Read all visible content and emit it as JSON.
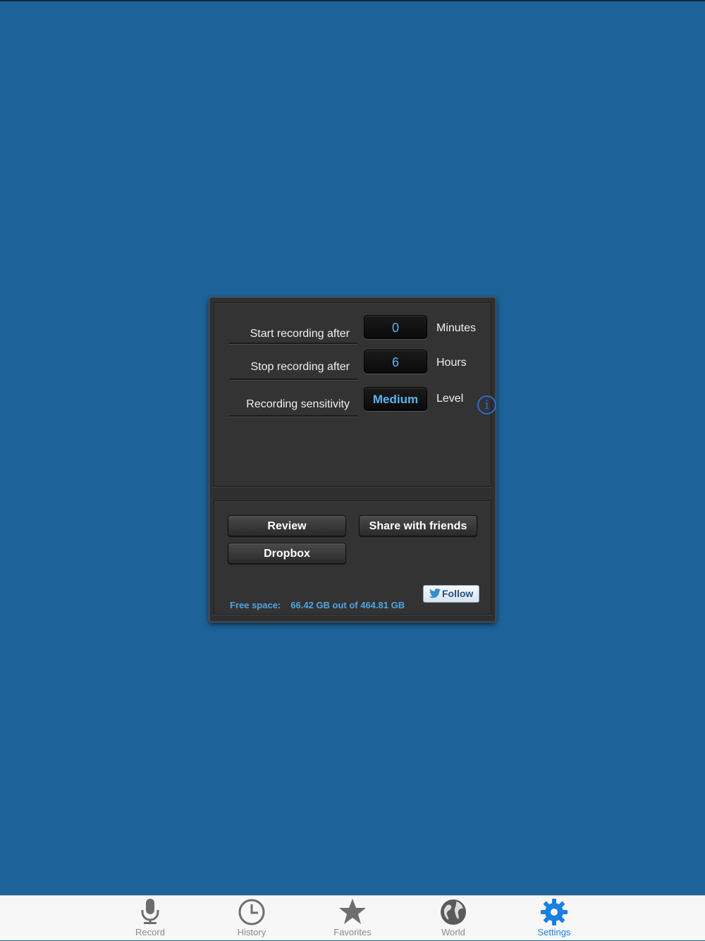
{
  "settings": {
    "start": {
      "label": "Start recording after",
      "value": "0",
      "unit": "Minutes"
    },
    "stop": {
      "label": "Stop recording after",
      "value": "6",
      "unit": "Hours"
    },
    "sensitivity": {
      "label": "Recording sensitivity",
      "value": "Medium",
      "unit": "Level"
    },
    "info_glyph": "i"
  },
  "buttons": {
    "review": "Review",
    "share": "Share with friends",
    "dropbox": "Dropbox",
    "follow": "Follow"
  },
  "storage": {
    "label": "Free space:",
    "value": "66.42 GB out of 464.81 GB"
  },
  "tabbar": {
    "items": [
      {
        "label": "Record",
        "icon": "microphone-icon",
        "active": false
      },
      {
        "label": "History",
        "icon": "clock-icon",
        "active": false
      },
      {
        "label": "Favorites",
        "icon": "star-icon",
        "active": false
      },
      {
        "label": "World",
        "icon": "globe-icon",
        "active": false
      },
      {
        "label": "Settings",
        "icon": "gear-icon",
        "active": true
      }
    ]
  },
  "colors": {
    "background": "#1d6399",
    "accent": "#5ab4ee",
    "tab_active": "#1a80e0"
  }
}
